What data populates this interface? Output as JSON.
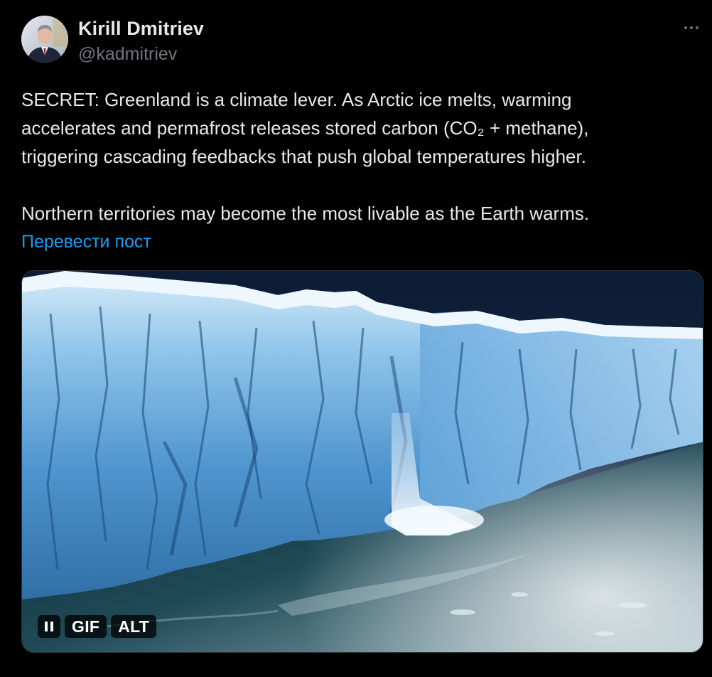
{
  "author": {
    "name": "Kirill Dmitriev",
    "handle": "@kadmitriev",
    "avatar_icon": "profile-photo"
  },
  "tweet": {
    "lines": [
      "SECRET: Greenland is a climate lever. As Arctic ice melts, warming",
      "accelerates and permafrost releases stored carbon (CO₂ + methane),",
      "triggering cascading feedbacks that push global temperatures higher.",
      "Northern territories may become the most livable as the Earth warms."
    ],
    "translate_label": "Перевести пост"
  },
  "media": {
    "type": "gif",
    "gif_badge": "GIF",
    "alt_badge": "ALT",
    "pause_icon": "pause-icon",
    "description_icon": "glacier-calving-image"
  },
  "menu": {
    "more_icon": "more-options-icon"
  },
  "colors": {
    "background": "#000000",
    "text_primary": "#e7e9ea",
    "text_secondary": "#71767b",
    "link": "#1d9bf0"
  }
}
